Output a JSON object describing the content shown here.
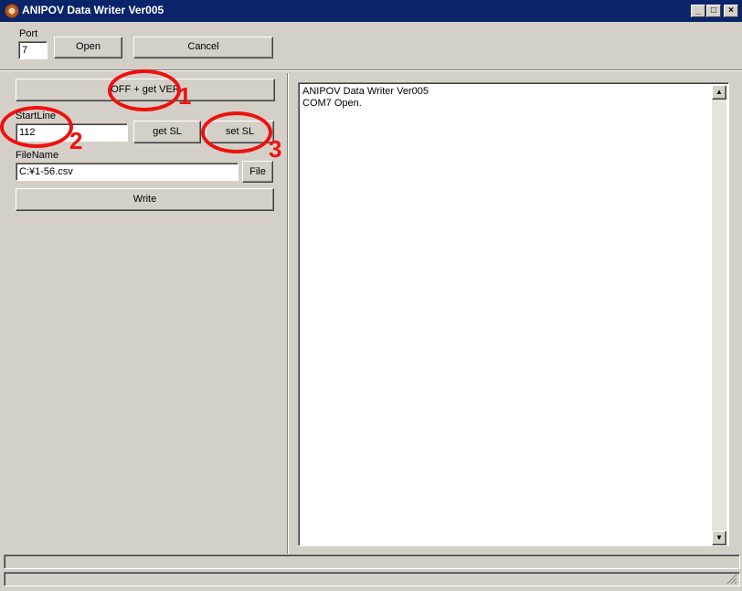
{
  "window": {
    "title": "ANIPOV Data Writer Ver005",
    "controls": {
      "minimize": "_",
      "maximize": "□",
      "close": "×"
    }
  },
  "top": {
    "port_label": "Port",
    "port_value": "7",
    "open_label": "Open",
    "cancel_label": "Cancel"
  },
  "left": {
    "off_get_ver_label": "OFF + get VER",
    "startline_label": "StartLine",
    "startline_value": "112",
    "get_sl_label": "get SL",
    "set_sl_label": "set SL",
    "filename_label": "FileName",
    "filename_value": "C:¥1-56.csv",
    "file_label": "File",
    "write_label": "Write"
  },
  "log": {
    "line1": "ANIPOV Data Writer Ver005",
    "line2": "COM7 Open."
  },
  "annotations": {
    "n1": "1",
    "n2": "2",
    "n3": "3",
    "color": "#ee1111"
  },
  "colors": {
    "titlebar": "#0a246a",
    "face": "#d4d0c8"
  }
}
